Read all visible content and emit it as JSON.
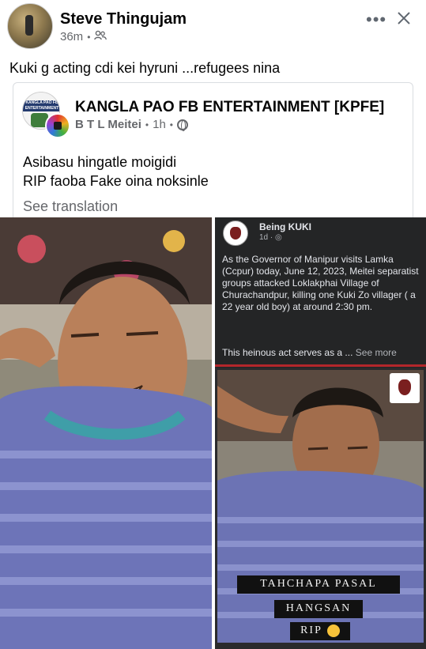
{
  "post": {
    "author": "Steve Thingujam",
    "time": "36m",
    "audience_icon": "friends-icon",
    "more_icon": "more-horizontal-icon",
    "close_icon": "close-icon",
    "caption": "Kuki g acting cdi kei hyruni ...refugees nina"
  },
  "shared": {
    "page_name": "KANGLA PAO FB ENTERTAINMENT [KPFE]",
    "page_logo_text": "KANGLA PAO FB ENTERTAINMENT",
    "poster": "B T L Meitei",
    "time": "1h",
    "privacy_icon": "globe-icon",
    "text_line1": "Asibasu hingatle moigidi",
    "text_line2": "RIP faoba Fake oina noksinle",
    "see_translation": "See translation"
  },
  "screenshot_post": {
    "name": "Being KUKI",
    "time": "1d",
    "body": "As the Governor of Manipur visits Lamka (Ccpur) today, June 12, 2023, Meitei separatist groups attacked Loklakphai Village of Churachandpur, killing one Kuki Zo villager ( a 22 year old boy) at around 2:30 pm.",
    "body2": "This heinous act serves as a ...",
    "see_more": "See more",
    "banner1": "TAHCHAPA PASAL",
    "banner2": "HANGSAN",
    "banner3": "RIP"
  },
  "colors": {
    "secondary_text": "#65676b",
    "dark_card": "#242526",
    "divider": "#b3262b"
  }
}
